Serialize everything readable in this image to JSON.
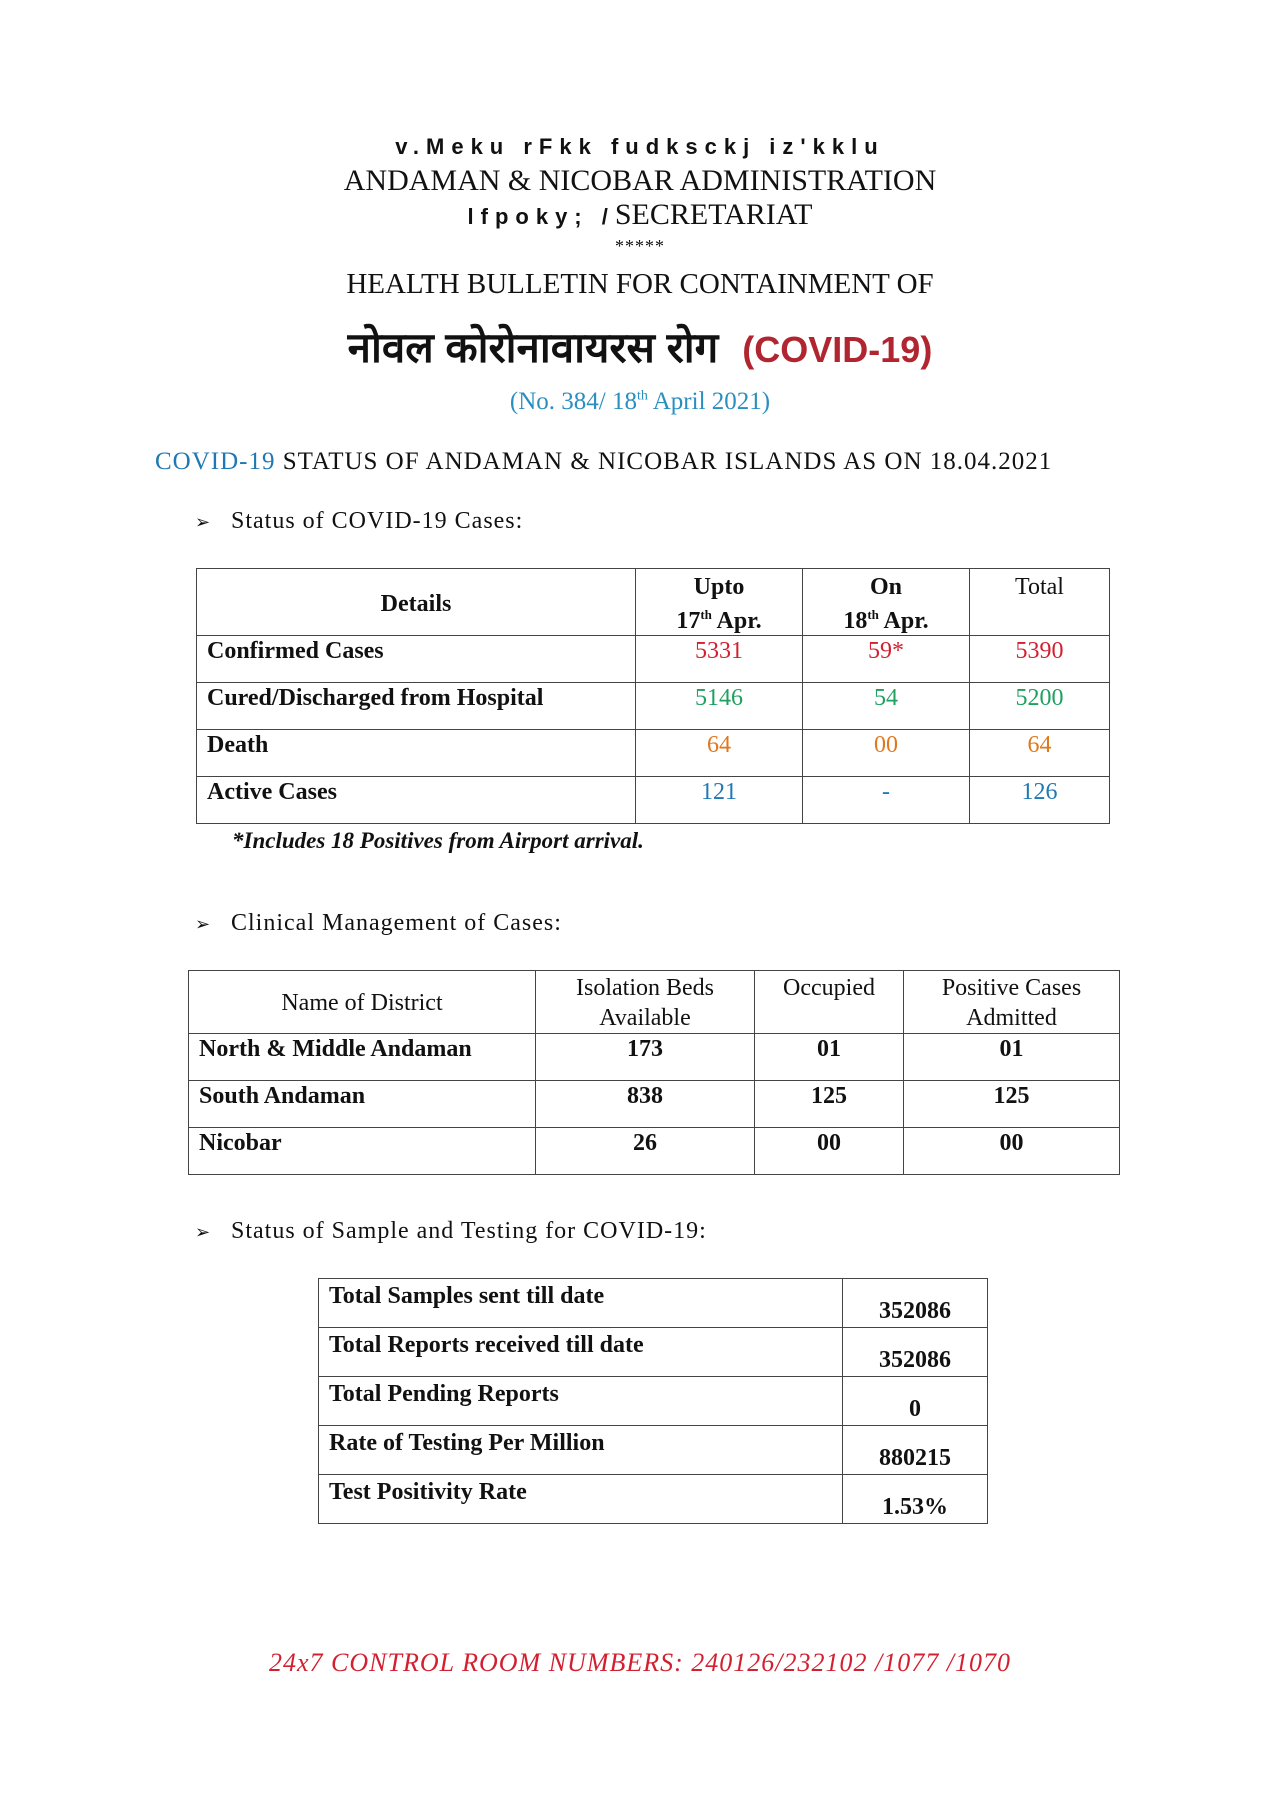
{
  "header": {
    "hindi_admin_garbled": "v.Meku rFkk fudksckj iz'kklu",
    "admin": "ANDAMAN & NICOBAR ADMINISTRATION",
    "secretariat_hindi_garbled": "lfpoky; /",
    "secretariat": "SECRETARIAT",
    "stars": "*****",
    "bulletin": "HEALTH BULLETIN FOR CONTAINMENT OF",
    "disease_hindi": "नोवल कोरोनावायरस रोग",
    "disease_tag": "(COVID-19)",
    "bulletin_no_prefix": "(No. 384/ 18",
    "bulletin_no_sup": "th",
    "bulletin_no_suffix": " April 2021)"
  },
  "status_line": {
    "accent": "COVID-19",
    "rest": " STATUS OF ANDAMAN & NICOBAR ISLANDS AS ON 18.04.2021"
  },
  "cases": {
    "heading": "Status of COVID-19 Cases:",
    "headers": {
      "details": "Details",
      "upto_line1": "Upto",
      "upto_day": "17",
      "upto_sup": "th",
      "upto_month": " Apr.",
      "on_line1": "On",
      "on_day": "18",
      "on_sup": "th",
      "on_month": " Apr.",
      "total": "Total"
    },
    "rows": [
      {
        "label": "Confirmed Cases",
        "upto": "5331",
        "on": "59*",
        "total": "5390"
      },
      {
        "label": "Cured/Discharged from Hospital",
        "upto": "5146",
        "on": "54",
        "total": "5200"
      },
      {
        "label": "Death",
        "upto": "64",
        "on": "00",
        "total": "64"
      },
      {
        "label": "Active Cases",
        "upto": "121",
        "on": "-",
        "total": "126"
      }
    ],
    "footnote": "*Includes 18 Positives from Airport arrival."
  },
  "clinical": {
    "heading": "Clinical Management of Cases:",
    "headers": {
      "district": "Name of District",
      "beds_line1": "Isolation Beds",
      "beds_line2": "Available",
      "occupied": "Occupied",
      "positive_line1": "Positive Cases",
      "positive_line2": "Admitted"
    },
    "rows": [
      {
        "district": "North & Middle Andaman",
        "beds": "173",
        "occupied": "01",
        "admitted": "01"
      },
      {
        "district": "South Andaman",
        "beds": "838",
        "occupied": "125",
        "admitted": "125"
      },
      {
        "district": "Nicobar",
        "beds": "26",
        "occupied": "00",
        "admitted": "00"
      }
    ]
  },
  "testing": {
    "heading": "Status of Sample and Testing for COVID-19:",
    "rows": [
      {
        "label": "Total Samples sent till date",
        "value": "352086"
      },
      {
        "label": "Total Reports received till date",
        "value": "352086"
      },
      {
        "label": "Total Pending Reports",
        "value": "0"
      },
      {
        "label": "Rate of Testing Per Million",
        "value": "880215"
      },
      {
        "label": "Test Positivity Rate",
        "value": "1.53%"
      }
    ]
  },
  "footer": {
    "control_room": "24x7 CONTROL ROOM NUMBERS: 240126/232102 /1077 /1070"
  },
  "colors": {
    "confirmed": "#d32030",
    "cured": "#1fa060",
    "death": "#e0781e",
    "active": "#1f78b4",
    "covid_tag": "#b02530",
    "bulletin_no": "#2a8fc0"
  }
}
